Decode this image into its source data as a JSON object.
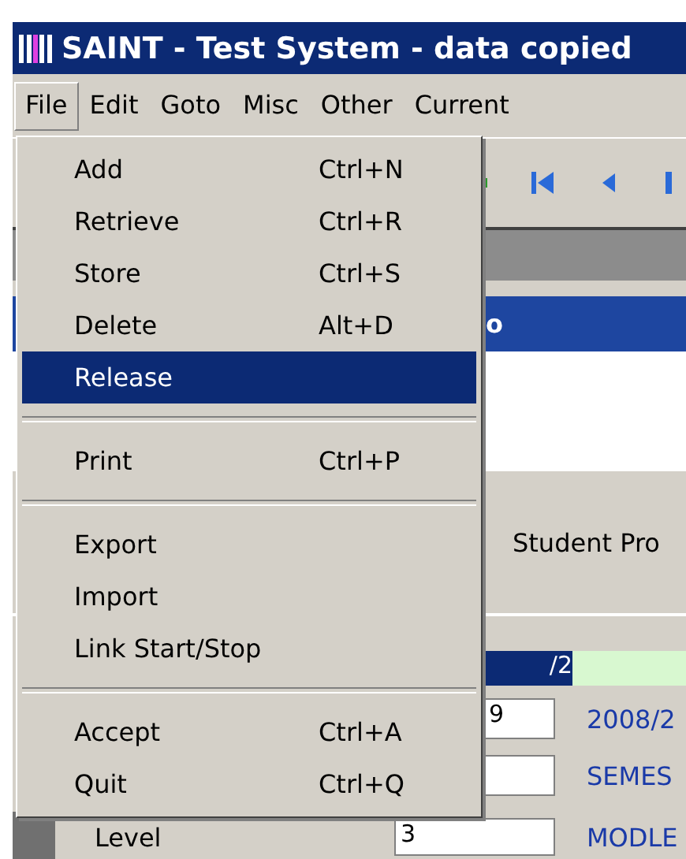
{
  "window": {
    "title": "SAINT - Test System - data copied"
  },
  "menu_bar": [
    {
      "label": "File",
      "selected": true
    },
    {
      "label": "Edit",
      "selected": false
    },
    {
      "label": "Goto",
      "selected": false
    },
    {
      "label": "Misc",
      "selected": false
    },
    {
      "label": "Other",
      "selected": false
    },
    {
      "label": "Current",
      "selected": false
    }
  ],
  "file_menu": [
    {
      "kind": "item",
      "label": "Add",
      "shortcut": "Ctrl+N",
      "selected": false
    },
    {
      "kind": "item",
      "label": "Retrieve",
      "shortcut": "Ctrl+R",
      "selected": false
    },
    {
      "kind": "item",
      "label": "Store",
      "shortcut": "Ctrl+S",
      "selected": false
    },
    {
      "kind": "item",
      "label": "Delete",
      "shortcut": "Alt+D",
      "selected": false
    },
    {
      "kind": "item",
      "label": "Release",
      "selected": true
    },
    {
      "kind": "separator"
    },
    {
      "kind": "item",
      "label": "Print",
      "shortcut": "Ctrl+P",
      "selected": false
    },
    {
      "kind": "separator"
    },
    {
      "kind": "item",
      "label": "Export",
      "selected": false
    },
    {
      "kind": "item",
      "label": "Import",
      "selected": false
    },
    {
      "kind": "item",
      "label": "Link Start/Stop",
      "selected": false
    },
    {
      "kind": "separator"
    },
    {
      "kind": "item",
      "label": "Accept",
      "shortcut": "Ctrl+A",
      "selected": false
    },
    {
      "kind": "item",
      "label": "Quit",
      "shortcut": "Ctrl+Q",
      "selected": false
    }
  ],
  "panel_header": {
    "title": "o"
  },
  "section_label": "Student Pro",
  "grid_row": {
    "cell": "/2",
    "selected": true
  },
  "fields": [
    {
      "value": "9",
      "note": "2008/2"
    },
    {
      "note": "SEMES"
    },
    {
      "label": "Level",
      "value": "3",
      "note": "MODLE"
    }
  ]
}
